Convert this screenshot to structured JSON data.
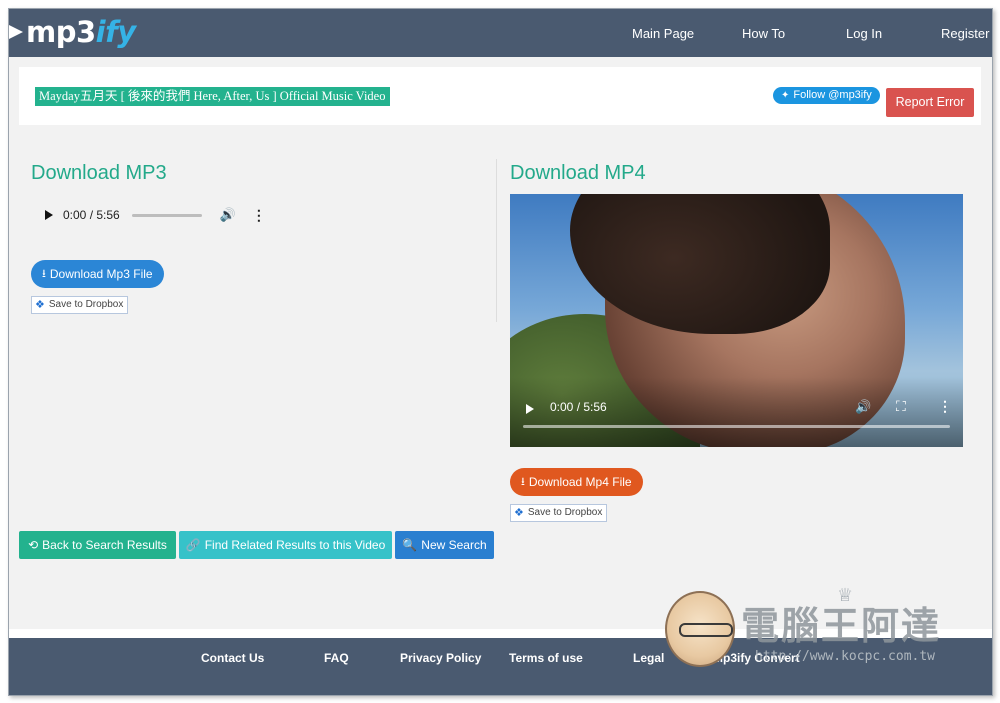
{
  "header": {
    "logo_main": "mp3",
    "logo_accent": "ify",
    "nav": [
      "Main Page",
      "How To",
      "Log In",
      "Register"
    ]
  },
  "title_panel": {
    "video_title": "Mayday五月天 [ 後來的我們 Here, After, Us ] Official Music Video",
    "follow_label": "Follow @mp3ify",
    "report_label": "Report Error"
  },
  "mp3": {
    "heading": "Download MP3",
    "player_time": "0:00 / 5:56",
    "download_label": "Download Mp3 File",
    "dropbox_label": "Save to Dropbox"
  },
  "mp4": {
    "heading": "Download MP4",
    "player_time": "0:00 / 5:56",
    "download_label": "Download Mp4 File",
    "dropbox_label": "Save to Dropbox"
  },
  "actions": {
    "back_label": "Back to Search Results",
    "related_label": "Find Related Results to this Video",
    "new_search_label": "New Search"
  },
  "footer": {
    "links": [
      "Contact Us",
      "FAQ",
      "Privacy Policy",
      "Terms of use",
      "Legal",
      "Mp3ify Convert"
    ]
  },
  "watermark": {
    "title": "電腦王阿達",
    "url": "http://www.kocpc.com.tw"
  },
  "colors": {
    "header_bg": "#4a5a70",
    "accent_green": "#23b28e",
    "button_blue": "#2b86d6",
    "button_orange": "#e0581f",
    "report_red": "#d9534f"
  },
  "icons": {
    "download": "download-icon",
    "dropbox": "dropbox-icon",
    "twitter": "twitter-bird-icon",
    "back": "history-icon",
    "link": "link-icon",
    "search": "search-icon"
  }
}
